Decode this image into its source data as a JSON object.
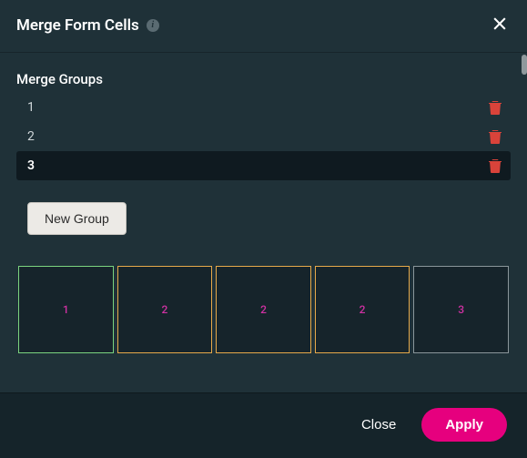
{
  "header": {
    "title": "Merge Form Cells",
    "info_label": "i"
  },
  "section_label": "Merge Groups",
  "groups": [
    {
      "id": "1",
      "selected": false
    },
    {
      "id": "2",
      "selected": false
    },
    {
      "id": "3",
      "selected": true
    }
  ],
  "new_group_label": "New Group",
  "cells": [
    {
      "group": 1,
      "label": "1"
    },
    {
      "group": 2,
      "label": "2"
    },
    {
      "group": 2,
      "label": "2"
    },
    {
      "group": 2,
      "label": "2"
    },
    {
      "group": 3,
      "label": "3"
    }
  ],
  "footer": {
    "close": "Close",
    "apply": "Apply"
  },
  "colors": {
    "accent": "#e6007e",
    "group1": "#7bd47f",
    "group2": "#e6a94a",
    "group3": "#8a969b",
    "trash": "#d9433a"
  }
}
